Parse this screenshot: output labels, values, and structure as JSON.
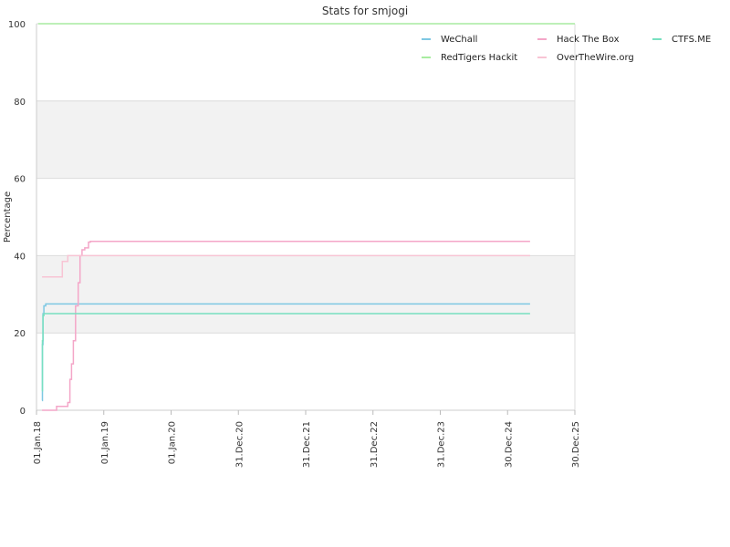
{
  "chart_data": {
    "type": "line",
    "title": "Stats for smjogi",
    "ylabel": "Percentage",
    "xlabel": "",
    "ylim": [
      0,
      100
    ],
    "yticks": [
      0,
      20,
      40,
      60,
      80,
      100
    ],
    "grid": true,
    "legend_position": "top-right",
    "xlim": [
      "2018-01-01",
      "2025-12-30"
    ],
    "xticks": [
      {
        "date": "2018-01-01",
        "label": "01.Jan.18"
      },
      {
        "date": "2019-01-01",
        "label": "01.Jan.19"
      },
      {
        "date": "2020-01-01",
        "label": "01.Jan.20"
      },
      {
        "date": "2020-12-31",
        "label": "31.Dec.20"
      },
      {
        "date": "2021-12-31",
        "label": "31.Dec.21"
      },
      {
        "date": "2022-12-31",
        "label": "31.Dec.22"
      },
      {
        "date": "2023-12-31",
        "label": "31.Dec.23"
      },
      {
        "date": "2024-12-30",
        "label": "30.Dec.24"
      },
      {
        "date": "2025-12-30",
        "label": "30.Dec.25"
      }
    ],
    "series": [
      {
        "name": "WeChall",
        "color": "#7ec8e3",
        "points": [
          [
            "2018-01-31",
            2.5
          ],
          [
            "2018-02-02",
            17
          ],
          [
            "2018-02-05",
            25
          ],
          [
            "2018-02-10",
            27
          ],
          [
            "2018-02-20",
            27.5
          ],
          [
            "2025-05-01",
            27.5
          ]
        ]
      },
      {
        "name": "Hack The Box",
        "color": "#f4a6c8",
        "points": [
          [
            "2018-01-31",
            0
          ],
          [
            "2018-04-20",
            1
          ],
          [
            "2018-06-20",
            2
          ],
          [
            "2018-07-01",
            8
          ],
          [
            "2018-07-10",
            12
          ],
          [
            "2018-07-20",
            18
          ],
          [
            "2018-08-01",
            27
          ],
          [
            "2018-08-15",
            33
          ],
          [
            "2018-08-25",
            40
          ],
          [
            "2018-09-05",
            41.5
          ],
          [
            "2018-09-20",
            42
          ],
          [
            "2018-10-10",
            43.5
          ],
          [
            "2018-10-20",
            43.7
          ],
          [
            "2025-05-01",
            43.7
          ]
        ]
      },
      {
        "name": "CTFS.ME",
        "color": "#78e0c0",
        "points": [
          [
            "2018-01-31",
            5
          ],
          [
            "2018-02-02",
            18
          ],
          [
            "2018-02-05",
            24.5
          ],
          [
            "2018-02-10",
            25
          ],
          [
            "2025-05-01",
            25
          ]
        ]
      },
      {
        "name": "RedTigers Hackit",
        "color": "#a8eca0",
        "points": [
          [
            "2018-01-10",
            100
          ],
          [
            "2025-12-30",
            100
          ]
        ]
      },
      {
        "name": "OverTheWire.org",
        "color": "#f8c4d4",
        "points": [
          [
            "2018-01-31",
            34.5
          ],
          [
            "2018-05-20",
            34.5
          ],
          [
            "2018-05-21",
            38.5
          ],
          [
            "2018-06-20",
            40
          ],
          [
            "2025-05-01",
            40
          ]
        ]
      }
    ]
  }
}
